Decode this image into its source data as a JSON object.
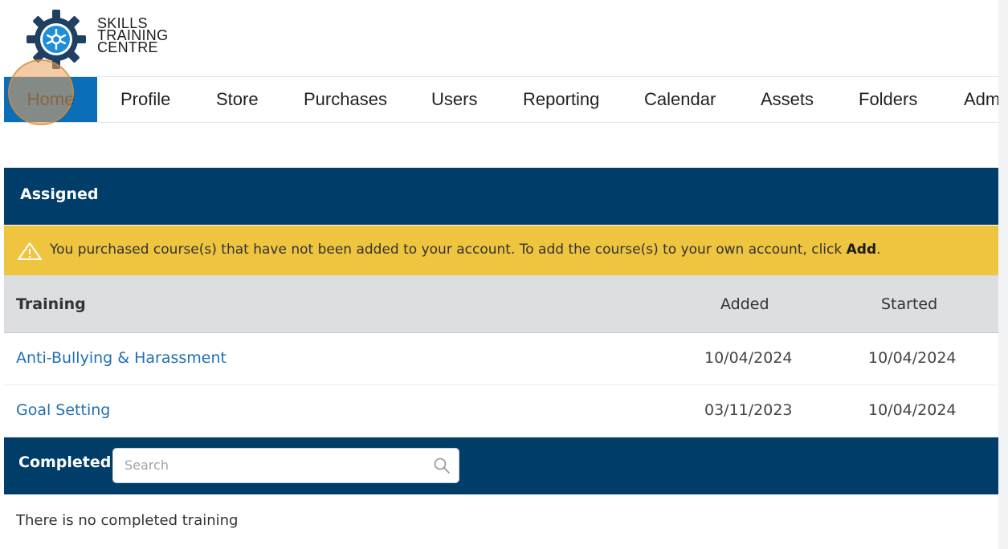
{
  "logo": {
    "lines": [
      "SKILLS",
      "TRAINING",
      "CENTRE"
    ],
    "icon": "gear-logo-icon"
  },
  "nav": {
    "items": [
      "Home",
      "Profile",
      "Store",
      "Purchases",
      "Users",
      "Reporting",
      "Calendar",
      "Assets",
      "Folders",
      "Adm"
    ],
    "active": "Home"
  },
  "assigned": {
    "title": "Assigned",
    "alert": {
      "icon": "warning-icon",
      "message": "You purchased course(s) that have not been added to your account. To add the course(s) to your own account, click ",
      "action": "Add",
      "end": "."
    },
    "columns": [
      "Training",
      "Added",
      "Started"
    ],
    "rows": [
      {
        "title": "Anti-Bullying & Harassment",
        "added": "10/04/2024",
        "started": "10/04/2024"
      },
      {
        "title": "Goal Setting",
        "added": "03/11/2023",
        "started": "10/04/2024"
      }
    ]
  },
  "completed": {
    "title": "Completed",
    "search_placeholder": "Search",
    "empty": "There is no completed training"
  },
  "colors": {
    "brand_dark": "#003d69",
    "nav_active": "#0a6fb8",
    "alert": "#efc43e",
    "link": "#1f6fb4"
  }
}
